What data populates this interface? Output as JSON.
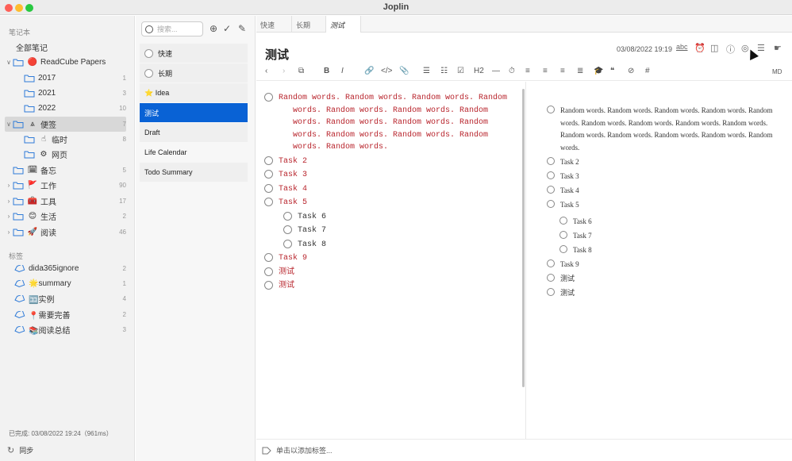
{
  "window": {
    "title": "Joplin"
  },
  "sidebar": {
    "notebooks_header": "笔记本",
    "notebooks": [
      {
        "chev": "",
        "emoji": "",
        "label": "全部笔记",
        "count": "",
        "indent": 0,
        "folder": false
      },
      {
        "chev": "∨",
        "emoji": "🔴",
        "label": "ReadCube Papers",
        "count": "",
        "indent": 0,
        "folder": true
      },
      {
        "chev": "",
        "emoji": "",
        "label": "2017",
        "count": "1",
        "indent": 1,
        "folder": true
      },
      {
        "chev": "",
        "emoji": "",
        "label": "2021",
        "count": "3",
        "indent": 1,
        "folder": true
      },
      {
        "chev": "",
        "emoji": "",
        "label": "2022",
        "count": "10",
        "indent": 1,
        "folder": true
      },
      {
        "chev": "∨",
        "emoji": "⩓",
        "label": "便签",
        "count": "7",
        "indent": 0,
        "folder": true,
        "selected": true
      },
      {
        "chev": "",
        "emoji": "☝",
        "label": "临时",
        "count": "8",
        "indent": 1,
        "folder": true
      },
      {
        "chev": "",
        "emoji": "⚙",
        "label": "网页",
        "count": "",
        "indent": 1,
        "folder": true
      },
      {
        "chev": "",
        "emoji": "🗓",
        "label": "备忘",
        "count": "5",
        "indent": 0,
        "folder": true
      },
      {
        "chev": "›",
        "emoji": "🚩",
        "label": "工作",
        "count": "90",
        "indent": 0,
        "folder": true
      },
      {
        "chev": "›",
        "emoji": "🧰",
        "label": "工具",
        "count": "17",
        "indent": 0,
        "folder": true
      },
      {
        "chev": "›",
        "emoji": "😊",
        "label": "生活",
        "count": "2",
        "indent": 0,
        "folder": true
      },
      {
        "chev": "›",
        "emoji": "🚀",
        "label": "阅读",
        "count": "46",
        "indent": 0,
        "folder": true
      }
    ],
    "tags_header": "标签",
    "tags": [
      {
        "label": "dida365ignore",
        "count": "2"
      },
      {
        "label": "🌟summary",
        "count": "1"
      },
      {
        "label": "🈁实例",
        "count": "4"
      },
      {
        "label": "📍需要完善",
        "count": "2"
      },
      {
        "label": "📚阅读总结",
        "count": "3"
      }
    ],
    "status": "已完成: 03/08/2022 19:24（961ms）",
    "sync_label": "同步"
  },
  "notelist": {
    "search_placeholder": "搜索...",
    "notes": [
      {
        "label": "快速",
        "todo": true
      },
      {
        "label": "长期",
        "todo": true
      },
      {
        "label": "⭐ Idea",
        "todo": false
      },
      {
        "label": "测试",
        "todo": false,
        "selected": true
      },
      {
        "label": "Draft",
        "todo": false
      },
      {
        "label": "Life Calendar",
        "todo": false
      },
      {
        "label": "Todo Summary",
        "todo": false
      }
    ]
  },
  "editor": {
    "tabs": [
      "快速",
      "长期",
      "测试"
    ],
    "active_tab": 2,
    "title": "测试",
    "date": "03/08/2022 19:19",
    "spell": "abc",
    "md_mode": "MD",
    "heading_btn": "H2",
    "tag_placeholder": "单击以添加标签...",
    "md_lines": [
      {
        "text": "Random words. Random words. Random words. Random\n   words. Random words. Random words. Random\n   words. Random words. Random words. Random\n   words. Random words. Random words. Random\n   words. Random words.",
        "indent": 0
      },
      {
        "text": "Task 2",
        "indent": 0
      },
      {
        "text": "Task 3",
        "indent": 0
      },
      {
        "text": "Task 4",
        "indent": 0
      },
      {
        "text": "Task 5",
        "indent": 0
      },
      {
        "text": "Task 6",
        "indent": 1
      },
      {
        "text": "Task 7",
        "indent": 1
      },
      {
        "text": "Task 8",
        "indent": 1
      },
      {
        "text": "Task 9",
        "indent": 0
      },
      {
        "text": "测试",
        "indent": 0
      },
      {
        "text": "测试",
        "indent": 0
      }
    ],
    "preview_lines": [
      {
        "text": "Random words. Random words. Random words. Random words. Random words. Random words. Random words. Random words. Random words. Random words. Random words. Random words. Random words. Random words.",
        "indent": 0
      },
      {
        "text": "Task 2",
        "indent": 0
      },
      {
        "text": "Task 3",
        "indent": 0
      },
      {
        "text": "Task 4",
        "indent": 0
      },
      {
        "text": "Task 5",
        "indent": 0
      },
      {
        "text": "Task 6",
        "indent": 1
      },
      {
        "text": "Task 7",
        "indent": 1
      },
      {
        "text": "Task 8",
        "indent": 1
      },
      {
        "text": "Task 9",
        "indent": 0
      },
      {
        "text": "测试",
        "indent": 0
      },
      {
        "text": "测试",
        "indent": 0
      }
    ]
  }
}
